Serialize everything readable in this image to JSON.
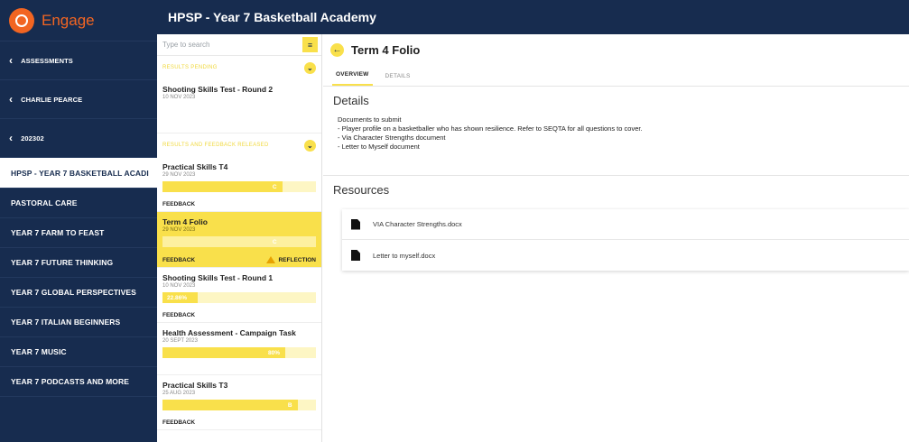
{
  "app": {
    "name": "Engage",
    "brand_color": "#f26522",
    "nav_color": "#172c4f",
    "accent_color": "#f9e04b"
  },
  "header": {
    "title": "HPSP - Year 7 Basketball Academy"
  },
  "sidebar": {
    "back_items": [
      {
        "label": "ASSESSMENTS",
        "icon": "chevron-left-icon"
      },
      {
        "label": "CHARLIE PEARCE",
        "icon": "chevron-left-icon"
      },
      {
        "label": "202302",
        "icon": "chevron-left-icon"
      }
    ],
    "active_item": "HPSP - YEAR 7 BASKETBALL ACADI",
    "items": [
      "PASTORAL CARE",
      "YEAR 7 FARM TO FEAST",
      "YEAR 7 FUTURE THINKING",
      "YEAR 7 GLOBAL PERSPECTIVES",
      "YEAR 7 ITALIAN BEGINNERS",
      "YEAR 7 MUSIC",
      "YEAR 7 PODCASTS AND MORE"
    ]
  },
  "list": {
    "search_placeholder": "Type to search",
    "section_pending": "RESULTS PENDING",
    "section_released": "RESULTS AND FEEDBACK RELEASED",
    "pending_items": [
      {
        "title": "Shooting Skills Test - Round 2",
        "date": "10 NOV 2023"
      }
    ],
    "released_items": [
      {
        "title": "Practical Skills T4",
        "date": "29 NOV 2023",
        "grade": "C",
        "fill_pct": 78,
        "feedback": "FEEDBACK"
      },
      {
        "title": "Term 4 Folio",
        "date": "29 NOV 2023",
        "grade": "C",
        "fill_pct": 78,
        "feedback": "FEEDBACK",
        "reflection": "REFLECTION",
        "selected": true
      },
      {
        "title": "Shooting Skills Test - Round 1",
        "date": "10 NOV 2023",
        "grade": "22.86%",
        "fill_pct": 23,
        "feedback": "FEEDBACK"
      },
      {
        "title": "Health Assessment - Campaign Task",
        "date": "20 SEPT 2023",
        "grade": "80%",
        "fill_pct": 80,
        "feedback": ""
      },
      {
        "title": "Practical Skills T3",
        "date": "25 AUG 2023",
        "grade": "B",
        "fill_pct": 88,
        "feedback": "FEEDBACK"
      }
    ]
  },
  "detail": {
    "title": "Term 4 Folio",
    "tabs": [
      "OVERVIEW",
      "DETAILS"
    ],
    "details_heading": "Details",
    "description": [
      "Documents to submit",
      "- Player profile on a basketballer who has shown resilience. Refer to SEQTA for all questions to cover.",
      "- Via Character Strengths document",
      "- Letter to Myself document"
    ],
    "resources_heading": "Resources",
    "resources": [
      "VIA Character Strengths.docx",
      "Letter to myself.docx"
    ]
  }
}
